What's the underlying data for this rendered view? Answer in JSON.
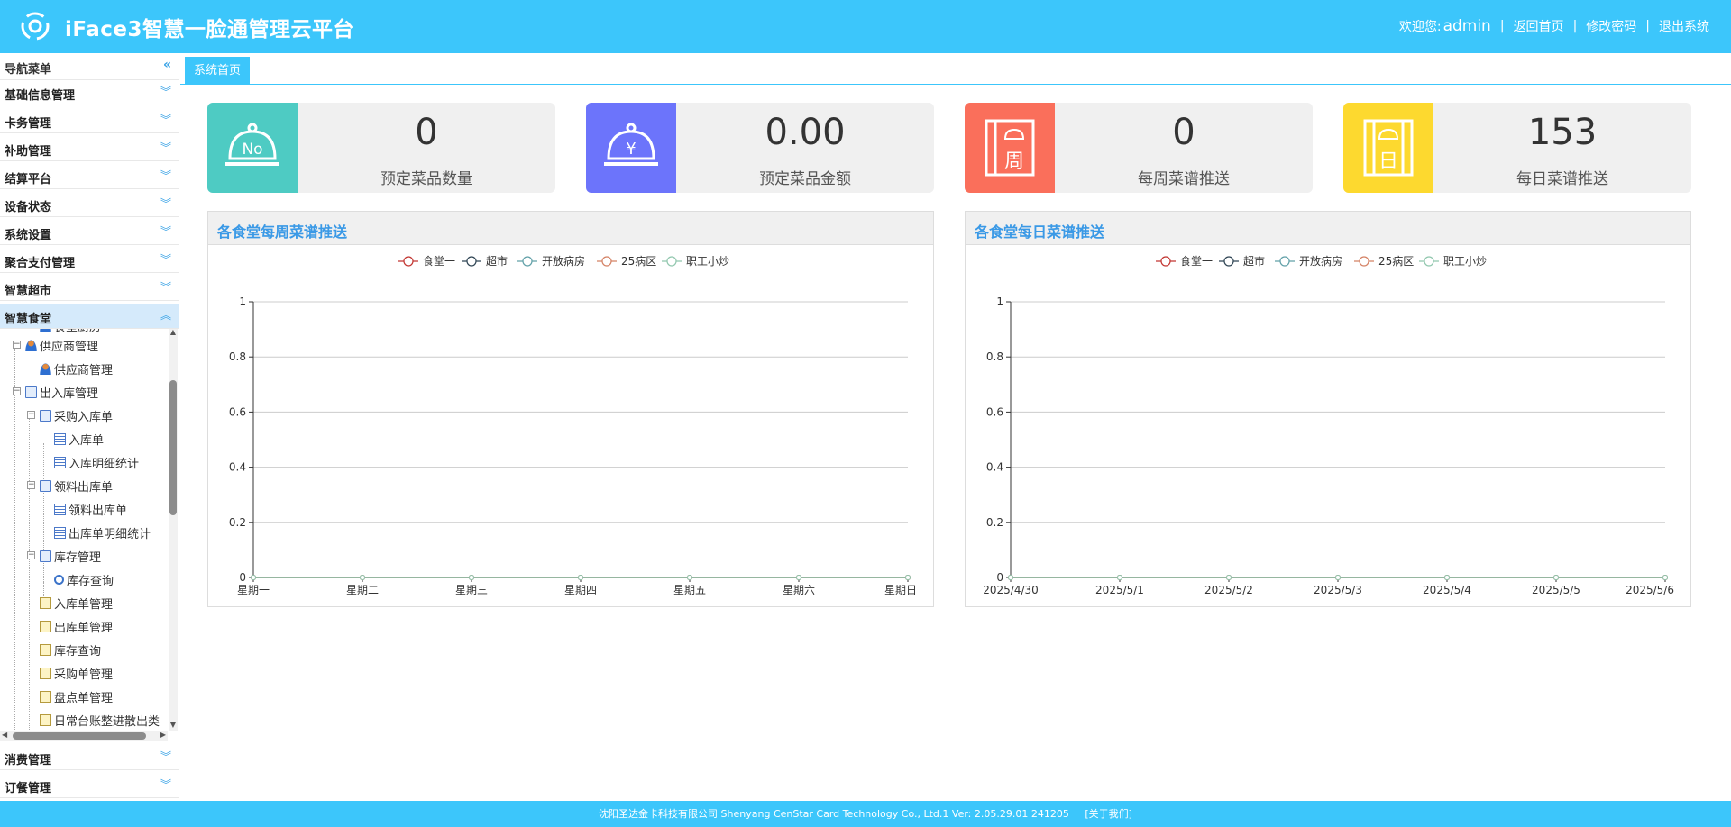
{
  "header": {
    "title": "iFace3智慧一脸通管理云平台",
    "welcome": "欢迎您:",
    "username": "admin",
    "links": [
      "返回首页",
      "修改密码",
      "退出系统"
    ]
  },
  "sidebar": {
    "menu_title": "导航菜单",
    "sections_top": [
      "基础信息管理",
      "卡务管理",
      "补助管理",
      "结算平台",
      "设备状态",
      "系统设置",
      "聚合支付管理",
      "智慧超市",
      "智慧食堂"
    ],
    "sections_bottom": [
      "消费管理",
      "订餐管理"
    ],
    "tree": [
      {
        "label": "食堂厨房",
        "icon": "person-icon"
      },
      {
        "label": "供应商管理",
        "icon": "person-icon"
      },
      {
        "label": "供应商管理",
        "icon": "person-icon"
      },
      {
        "label": "出入库管理",
        "icon": "folder-icon"
      },
      {
        "label": "采购入库单",
        "icon": "folder-icon"
      },
      {
        "label": "入库单",
        "icon": "list-icon"
      },
      {
        "label": "入库明细统计",
        "icon": "list-icon"
      },
      {
        "label": "领料出库单",
        "icon": "folder-icon"
      },
      {
        "label": "领料出库单",
        "icon": "list-icon"
      },
      {
        "label": "出库单明细统计",
        "icon": "list-icon"
      },
      {
        "label": "库存管理",
        "icon": "folder-icon"
      },
      {
        "label": "库存查询",
        "icon": "search-icon"
      },
      {
        "label": "入库单管理",
        "icon": "doc-icon"
      },
      {
        "label": "出库单管理",
        "icon": "doc-icon"
      },
      {
        "label": "库存查询",
        "icon": "doc-icon"
      },
      {
        "label": "采购单管理",
        "icon": "doc-icon"
      },
      {
        "label": "盘点单管理",
        "icon": "doc-icon"
      },
      {
        "label": "日常台账整进散出类",
        "icon": "doc-icon"
      }
    ]
  },
  "tabs": {
    "home": "系统首页"
  },
  "cards": [
    {
      "value": "0",
      "caption": "预定菜品数量",
      "color": "#4ecbc3",
      "icon": "cloche-no-icon",
      "icon_text": "No"
    },
    {
      "value": "0.00",
      "caption": "预定菜品金额",
      "color": "#6c74fb",
      "icon": "cloche-yen-icon",
      "icon_text": "¥"
    },
    {
      "value": "0",
      "caption": "每周菜谱推送",
      "color": "#fa6f5b",
      "icon": "weekly-menu-icon",
      "icon_text": "周"
    },
    {
      "value": "153",
      "caption": "每日菜谱推送",
      "color": "#fdd92f",
      "icon": "daily-menu-icon",
      "icon_text": "日"
    }
  ],
  "chart_data": [
    {
      "type": "line",
      "title": "各食堂每周菜谱推送",
      "categories": [
        "星期一",
        "星期二",
        "星期三",
        "星期四",
        "星期五",
        "星期六",
        "星期日"
      ],
      "ylim": [
        0,
        1
      ],
      "yticks": [
        "0",
        "0.2",
        "0.4",
        "0.6",
        "0.8",
        "1"
      ],
      "grid": true,
      "legend_position": "top-center",
      "series": [
        {
          "name": "食堂一",
          "color": "#c23531",
          "values": [
            0,
            0,
            0,
            0,
            0,
            0,
            0
          ]
        },
        {
          "name": "超市",
          "color": "#2f4554",
          "values": [
            0,
            0,
            0,
            0,
            0,
            0,
            0
          ]
        },
        {
          "name": "开放病房",
          "color": "#61a0a8",
          "values": [
            0,
            0,
            0,
            0,
            0,
            0,
            0
          ]
        },
        {
          "name": "25病区",
          "color": "#d48265",
          "values": [
            0,
            0,
            0,
            0,
            0,
            0,
            0
          ]
        },
        {
          "name": "职工小炒",
          "color": "#91c7ae",
          "values": [
            0,
            0,
            0,
            0,
            0,
            0,
            0
          ]
        }
      ]
    },
    {
      "type": "line",
      "title": "各食堂每日菜谱推送",
      "categories": [
        "2025/4/30",
        "2025/5/1",
        "2025/5/2",
        "2025/5/3",
        "2025/5/4",
        "2025/5/5",
        "2025/5/6"
      ],
      "ylim": [
        0,
        1
      ],
      "yticks": [
        "0",
        "0.2",
        "0.4",
        "0.6",
        "0.8",
        "1"
      ],
      "grid": true,
      "legend_position": "top-center",
      "series": [
        {
          "name": "食堂一",
          "color": "#c23531",
          "values": [
            0,
            0,
            0,
            0,
            0,
            0,
            0
          ]
        },
        {
          "name": "超市",
          "color": "#2f4554",
          "values": [
            0,
            0,
            0,
            0,
            0,
            0,
            0
          ]
        },
        {
          "name": "开放病房",
          "color": "#61a0a8",
          "values": [
            0,
            0,
            0,
            0,
            0,
            0,
            0
          ]
        },
        {
          "name": "25病区",
          "color": "#d48265",
          "values": [
            0,
            0,
            0,
            0,
            0,
            0,
            0
          ]
        },
        {
          "name": "职工小炒",
          "color": "#91c7ae",
          "values": [
            0,
            0,
            0,
            0,
            0,
            0,
            0
          ]
        }
      ]
    }
  ],
  "footer": {
    "text": "沈阳圣达金卡科技有限公司 Shenyang CenStar Card Technology Co., Ltd.1   Ver: 2.05.29.01 241205",
    "about": "[关于我们]"
  }
}
